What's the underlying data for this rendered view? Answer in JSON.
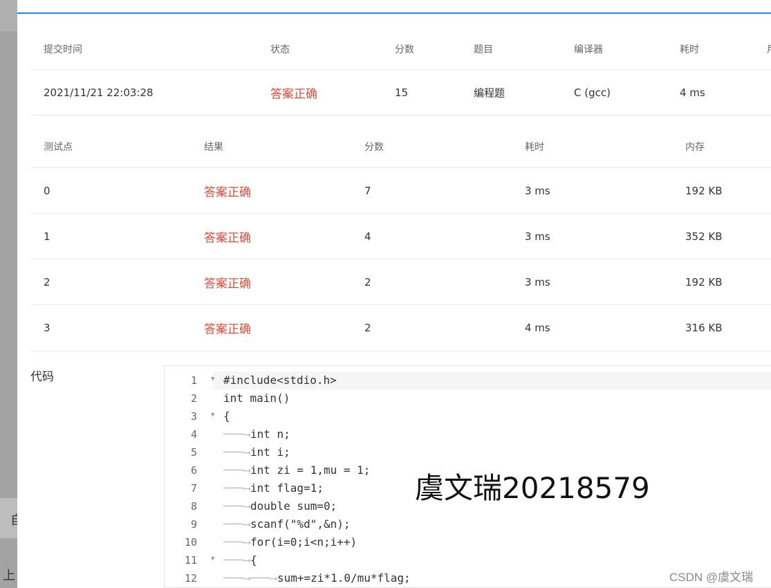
{
  "left_fragments": [
    "自",
    "上"
  ],
  "submission": {
    "headers": [
      "提交时间",
      "状态",
      "分数",
      "题目",
      "编译器",
      "耗时",
      "用"
    ],
    "row": [
      "2021/11/21 22:03:28",
      "答案正确",
      "15",
      "编程题",
      "C (gcc)",
      "4 ms"
    ]
  },
  "tests": {
    "headers": [
      "测试点",
      "结果",
      "分数",
      "耗时",
      "内存"
    ],
    "rows": [
      [
        "0",
        "答案正确",
        "7",
        "3 ms",
        "192 KB"
      ],
      [
        "1",
        "答案正确",
        "4",
        "3 ms",
        "352 KB"
      ],
      [
        "2",
        "答案正确",
        "2",
        "3 ms",
        "192 KB"
      ],
      [
        "3",
        "答案正确",
        "2",
        "4 ms",
        "316 KB"
      ]
    ]
  },
  "code_label": "代码",
  "code_lines": [
    {
      "n": "1",
      "text": "#include<stdio.h>"
    },
    {
      "n": "2",
      "text": "int main()"
    },
    {
      "n": "3",
      "text": "{"
    },
    {
      "n": "4",
      "text": "int n;"
    },
    {
      "n": "5",
      "text": "int i;"
    },
    {
      "n": "6",
      "text": "int zi = 1,mu = 1;"
    },
    {
      "n": "7",
      "text": "int flag=1;"
    },
    {
      "n": "8",
      "text": "double sum=0;"
    },
    {
      "n": "9",
      "text": "scanf(\"%d\",&n);"
    },
    {
      "n": "10",
      "text": "for(i=0;i<n;i++)"
    },
    {
      "n": "11",
      "text": "{"
    },
    {
      "n": "12",
      "text": "sum+=zi*1.0/mu*flag;"
    }
  ],
  "watermark_name": "虞文瑞20218579",
  "watermark_csdn": "CSDN @虞文瑞",
  "colors": {
    "accent": "#1e88e5",
    "status_ok": "#e04b3a"
  },
  "icons": [
    "fold-arrow-icon"
  ]
}
